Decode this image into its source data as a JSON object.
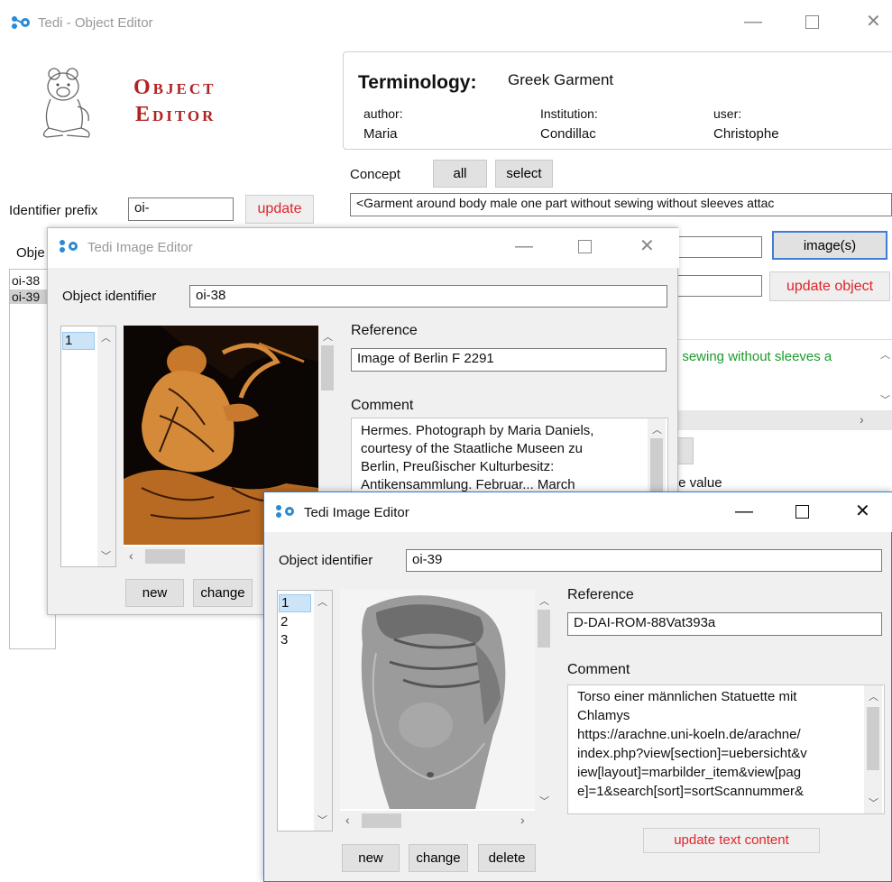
{
  "main": {
    "title": "Tedi - Object Editor",
    "logo_line1": "Object",
    "logo_line2": "Editor",
    "terminology_label": "Terminology:",
    "terminology_value": "Greek Garment",
    "author_label": "author:",
    "author_value": "Maria",
    "institution_label": "Institution:",
    "institution_value": "Condillac",
    "user_label": "user:",
    "user_value": "Christophe",
    "concept_label": "Concept",
    "all_btn": "all",
    "select_btn": "select",
    "concept_value": "<Garment around body male one part without sewing without sleeves attac",
    "identifier_prefix_label": "Identifier prefix",
    "identifier_prefix_value": "oi-",
    "update_btn": "update",
    "objects_label_partial": "Obje",
    "objects": [
      "oi-38",
      "oi-39"
    ],
    "images_btn": "image(s)",
    "update_object_btn": "update object",
    "green_text": "t sewing without sleeves a",
    "partial_value_text": "te value"
  },
  "image_editor_1": {
    "title": "Tedi Image Editor",
    "object_identifier_label": "Object identifier",
    "object_identifier_value": "oi-38",
    "list": [
      "1"
    ],
    "reference_label": "Reference",
    "reference_value": "Image of Berlin F 2291",
    "comment_label": "Comment",
    "comment_lines": [
      "Hermes. Photograph by Maria Daniels,",
      "courtesy of the Staatliche Museen zu",
      "Berlin, Preußischer Kulturbesitz:",
      "Antikensammlung. Februar... March"
    ],
    "new_btn": "new",
    "change_btn": "change"
  },
  "image_editor_2": {
    "title": "Tedi Image Editor",
    "object_identifier_label": "Object identifier",
    "object_identifier_value": "oi-39",
    "list": [
      "1",
      "2",
      "3"
    ],
    "reference_label": "Reference",
    "reference_value": "D-DAI-ROM-88Vat393a",
    "comment_label": "Comment",
    "comment_lines": [
      "Torso einer männlichen Statuette mit",
      "Chlamys",
      "https://arachne.uni-koeln.de/arachne/",
      "index.php?view[section]=uebersicht&v",
      "iew[layout]=marbilder_item&view[pag",
      "e]=1&search[sort]=sortScannummer&"
    ],
    "new_btn": "new",
    "change_btn": "change",
    "delete_btn": "delete",
    "update_text_btn": "update text content"
  },
  "colors": {
    "accent_red": "#e0242a",
    "logo_red": "#b22222",
    "green": "#1a9b2a",
    "window_border_active": "#2b7ad6"
  },
  "icons": {
    "app": "tedi-app-icon",
    "close": "close-icon",
    "minimize": "minimize-icon",
    "maximize": "maximize-icon"
  }
}
